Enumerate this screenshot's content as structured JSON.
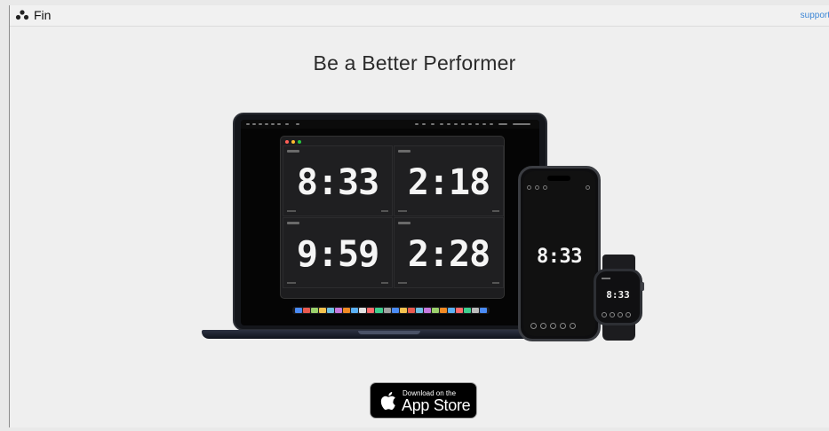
{
  "header": {
    "brand_name": "Fin",
    "brand_icon": "three-dots-logo-icon",
    "support_link": "support"
  },
  "hero": {
    "headline": "Be a Better Performer"
  },
  "devices": {
    "laptop_timers": [
      "8:33",
      "2:18",
      "9:59",
      "2:28"
    ],
    "phone_timer": "8:33",
    "watch_timer": "8:33"
  },
  "app_store_badge": {
    "small_text": "Download on the",
    "big_text": "App Store",
    "icon": "apple-logo-icon"
  },
  "colors": {
    "link": "#3c86d6",
    "background": "#efefef",
    "badge": "#000000"
  }
}
